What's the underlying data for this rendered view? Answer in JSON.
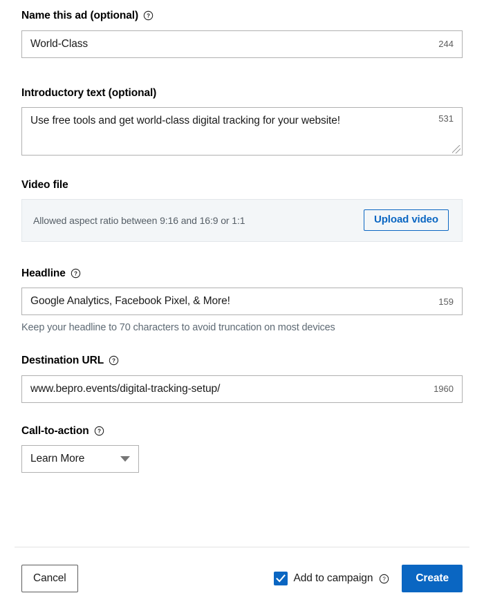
{
  "colors": {
    "accent_blue": "#0a66c2",
    "panel_bg": "#f3f6f8",
    "border_gray": "#b0b0b0",
    "helper_gray": "#5e6a74"
  },
  "fields": {
    "ad_name": {
      "label": "Name this ad (optional)",
      "value": "World-Class",
      "placeholder": "",
      "counter": "244",
      "help_icon": "help-circle-icon"
    },
    "intro_text": {
      "label": "Introductory text (optional)",
      "value": "Use free tools and get world-class digital tracking for your website!",
      "placeholder": "",
      "counter": "531"
    },
    "video_file": {
      "label": "Video file",
      "hint": "Allowed aspect ratio between 9:16 and 16:9 or 1:1",
      "upload_label": "Upload video",
      "upload_icon": "upload-icon"
    },
    "headline": {
      "label": "Headline",
      "value": "Google Analytics, Facebook Pixel, & More!",
      "placeholder": "",
      "counter": "159",
      "helper": "Keep your headline to 70 characters to avoid truncation on most devices",
      "help_icon": "help-circle-icon"
    },
    "destination_url": {
      "label": "Destination URL",
      "value": "www.bepro.events/digital-tracking-setup/",
      "placeholder": "",
      "counter": "1960",
      "help_icon": "help-circle-icon"
    },
    "call_to_action": {
      "label": "Call-to-action",
      "selected": "Learn More",
      "help_icon": "help-circle-icon",
      "caret_icon": "chevron-down-icon"
    }
  },
  "footer": {
    "cancel_label": "Cancel",
    "add_to_campaign_label": "Add to campaign",
    "add_to_campaign_checked": true,
    "add_to_campaign_help_icon": "help-circle-icon",
    "create_label": "Create"
  }
}
